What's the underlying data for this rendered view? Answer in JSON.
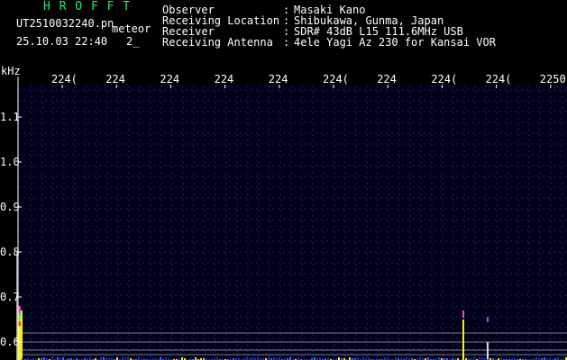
{
  "header": {
    "program": "H R O F F T",
    "filename": "UT2510032240.pn",
    "mode": "meteor",
    "datetime": "25.10.03 22:40",
    "page_fragment": "2_",
    "info": [
      {
        "key": "Observer",
        "sep": ":",
        "value": "Masaki Kano"
      },
      {
        "key": "Receiving Location",
        "sep": ":",
        "value": "Shibukawa, Gunma, Japan"
      },
      {
        "key": "Receiver",
        "sep": ":",
        "value": "SDR# 43dB L15 111.6MHz USB"
      },
      {
        "key": "Receiving Antenna",
        "sep": ":",
        "value": "4ele Yagi Az 230 for Kansai VOR"
      }
    ]
  },
  "chart_data": {
    "type": "heatmap",
    "ylabel": "kHz",
    "x_tick_labels": [
      "224(",
      "224",
      "224",
      "224",
      "224",
      "224(",
      "224",
      "224(",
      "224(",
      "2250"
    ],
    "y_tick_labels": [
      "1.1",
      "1.0",
      "0.9",
      "0.8",
      "0.7",
      "0.6"
    ],
    "y_tick_values": [
      1.1,
      1.0,
      0.9,
      0.8,
      0.7,
      0.6
    ],
    "colors": {
      "background": "#00001a",
      "grid": "#1a2a55",
      "axis": "#ffffff",
      "signal": "#ffee00",
      "echo": "#ff44aa",
      "band_line": "#9999aa"
    }
  }
}
